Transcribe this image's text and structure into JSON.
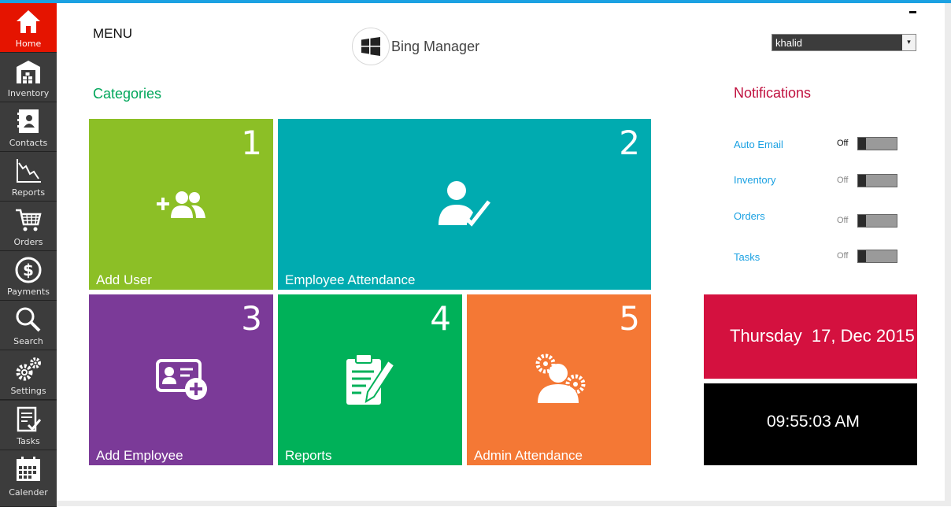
{
  "sidebar": {
    "items": [
      {
        "label": "Home",
        "icon": "home-icon",
        "active": true
      },
      {
        "label": "Inventory",
        "icon": "warehouse-icon"
      },
      {
        "label": "Contacts",
        "icon": "contacts-icon"
      },
      {
        "label": "Reports",
        "icon": "chart-icon"
      },
      {
        "label": "Orders",
        "icon": "cart-icon"
      },
      {
        "label": "Payments",
        "icon": "dollar-icon"
      },
      {
        "label": "Search",
        "icon": "search-icon"
      },
      {
        "label": "Settings",
        "icon": "gear-icon"
      },
      {
        "label": "Tasks",
        "icon": "tasks-icon"
      },
      {
        "label": "Calender",
        "icon": "calendar-icon"
      }
    ]
  },
  "header": {
    "menu_label": "MENU",
    "app_title": "Bing Manager",
    "user": "khalid",
    "user_arrow": "▾"
  },
  "categories": {
    "title": "Categories",
    "tiles": [
      {
        "number": "1",
        "label": "Add User",
        "color": "#8cbf26"
      },
      {
        "number": "2",
        "label": "Employee Attendance",
        "color": "#00abb0"
      },
      {
        "number": "3",
        "label": "Add Employee",
        "color": "#7b3a98"
      },
      {
        "number": "4",
        "label": "Reports",
        "color": "#00b159"
      },
      {
        "number": "5",
        "label": "Admin Attendance",
        "color": "#f47835"
      }
    ]
  },
  "notifications": {
    "title": "Notifications",
    "items": [
      {
        "label": "Auto Email",
        "state": "Off"
      },
      {
        "label": "Inventory",
        "state": "Off"
      },
      {
        "label": "Orders",
        "state": "Off"
      },
      {
        "label": "Tasks",
        "state": "Off"
      }
    ]
  },
  "date_text": "Thursday  17, Dec 2015",
  "time_text": "09:55:03 AM",
  "colors": {
    "accent_top": "#1ba1e2",
    "home_active": "#e51400",
    "categories_title": "#00a65a",
    "notifications_title": "#c0113f",
    "date_bg": "#d4113f",
    "time_bg": "#000000"
  }
}
